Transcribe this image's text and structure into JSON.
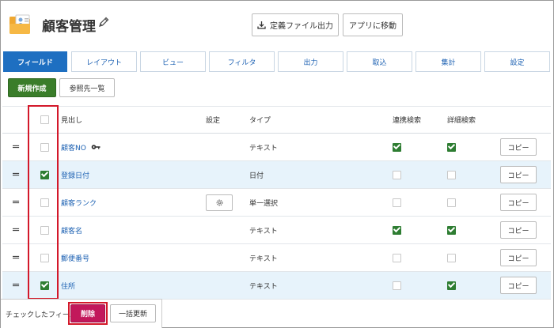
{
  "header": {
    "title": "顧客管理",
    "export_label": "定義ファイル出力",
    "move_label": "アプリに移動"
  },
  "tabs": [
    {
      "label": "フィールド",
      "active": true
    },
    {
      "label": "レイアウト"
    },
    {
      "label": "ビュー"
    },
    {
      "label": "フィルタ"
    },
    {
      "label": "出力"
    },
    {
      "label": "取込"
    },
    {
      "label": "集計"
    },
    {
      "label": "設定"
    }
  ],
  "actions": {
    "new_label": "新規作成",
    "ref_label": "参照先一覧"
  },
  "table": {
    "columns": {
      "heading": "見出し",
      "settings": "設定",
      "type": "タイプ",
      "link_search": "連携検索",
      "detail_search": "詳細検索"
    },
    "copy_label": "コピー",
    "rows": [
      {
        "name": "顧客NO",
        "type": "テキスト",
        "selected": false,
        "has_key": true,
        "has_settings": false,
        "link_search": true,
        "detail_search": true
      },
      {
        "name": "登録日付",
        "type": "日付",
        "selected": true,
        "has_key": false,
        "has_settings": false,
        "link_search": false,
        "detail_search": false
      },
      {
        "name": "顧客ランク",
        "type": "単一選択",
        "selected": false,
        "has_key": false,
        "has_settings": true,
        "link_search": false,
        "detail_search": false
      },
      {
        "name": "顧客名",
        "type": "テキスト",
        "selected": false,
        "has_key": false,
        "has_settings": false,
        "link_search": true,
        "detail_search": true
      },
      {
        "name": "郵便番号",
        "type": "テキスト",
        "selected": false,
        "has_key": false,
        "has_settings": false,
        "link_search": false,
        "detail_search": false
      },
      {
        "name": "住所",
        "type": "テキスト",
        "selected": true,
        "has_key": false,
        "has_settings": false,
        "link_search": false,
        "detail_search": true
      }
    ]
  },
  "footer": {
    "text": "チェックしたフィールドを",
    "delete_label": "削除",
    "bulk_update_label": "一括更新"
  },
  "colors": {
    "accent": "#1e6fc1",
    "new_button": "#3a7d2a",
    "delete_button": "#c2185b",
    "highlight": "#d3182a",
    "checked": "#2e7d32"
  }
}
